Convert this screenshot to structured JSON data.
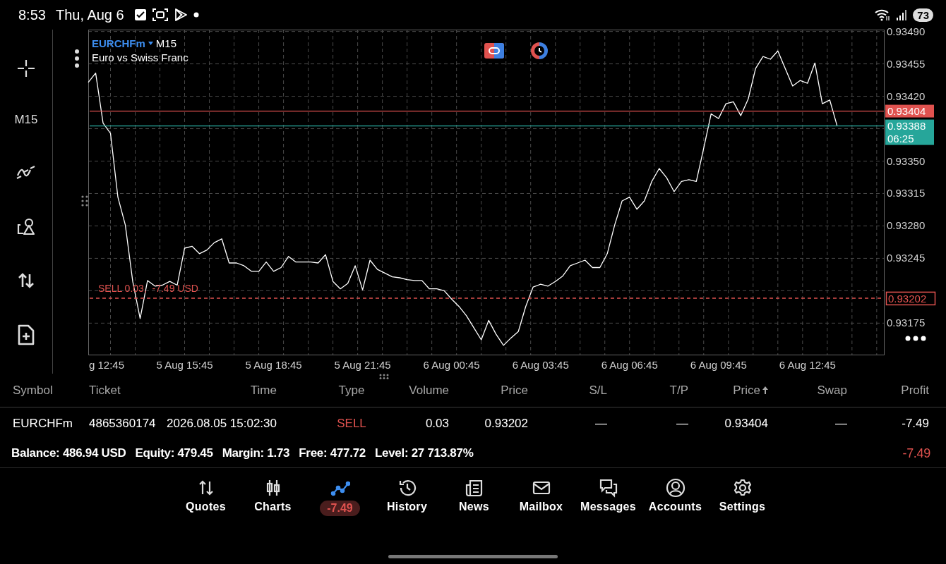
{
  "status_bar": {
    "time": "8:53",
    "date": "Thu, Aug 6",
    "battery": "73"
  },
  "toolbar": {
    "timeframe": "M15"
  },
  "chart": {
    "symbol": "EURCHFm",
    "timeframe": "M15",
    "description": "Euro vs Swiss Franc",
    "chart_data": {
      "type": "line",
      "grid": true,
      "categories": [
        null,
        null,
        null,
        "g 12:45",
        null,
        null,
        null,
        null,
        null,
        null,
        null,
        null,
        null,
        "5 Aug 15:45",
        null,
        null,
        null,
        null,
        null,
        null,
        null,
        null,
        null,
        null,
        null,
        "5 Aug 18:45",
        null,
        null,
        null,
        null,
        null,
        null,
        null,
        null,
        null,
        null,
        null,
        "5 Aug 21:45",
        null,
        null,
        null,
        null,
        null,
        null,
        null,
        null,
        null,
        null,
        null,
        "6 Aug 00:45",
        null,
        null,
        null,
        null,
        null,
        null,
        null,
        null,
        null,
        null,
        null,
        "6 Aug 03:45",
        null,
        null,
        null,
        null,
        null,
        null,
        null,
        null,
        null,
        null,
        null,
        "6 Aug 06:45",
        null,
        null,
        null,
        null,
        null,
        null,
        null,
        null,
        null,
        null,
        null,
        "6 Aug 09:45",
        null,
        null,
        null,
        null,
        null,
        null,
        null,
        null,
        null,
        null,
        null,
        "6 Aug 12:45",
        null,
        null,
        null,
        null,
        null,
        null,
        null,
        null,
        null,
        null
      ],
      "series": [
        {
          "color": "#ffffff",
          "values": [
            0.93435,
            0.93445,
            0.93391,
            0.9338,
            0.93311,
            0.93281,
            0.9322,
            0.9318,
            0.93221,
            0.93215,
            0.93216,
            0.9322,
            0.93216,
            0.93256,
            0.93258,
            0.9325,
            0.93254,
            0.93262,
            0.93266,
            0.9324,
            0.9324,
            0.93237,
            0.93231,
            0.93231,
            0.93241,
            0.93231,
            0.93235,
            0.93247,
            0.93241,
            0.93241,
            0.93241,
            0.9324,
            0.93249,
            0.9322,
            0.93212,
            0.93218,
            0.93237,
            0.93211,
            0.93243,
            0.93233,
            0.93229,
            0.93225,
            0.93224,
            0.93222,
            0.93221,
            0.93221,
            0.93212,
            0.93212,
            0.9321,
            0.93201,
            0.93193,
            0.93183,
            0.9317,
            0.93157,
            0.93178,
            0.93163,
            0.93151,
            0.93159,
            0.93166,
            0.93193,
            0.93214,
            0.93217,
            0.93215,
            0.9322,
            0.93226,
            0.93237,
            0.9324,
            0.93243,
            0.93235,
            0.93235,
            0.9325,
            0.93281,
            0.93307,
            0.93311,
            0.93298,
            0.93307,
            0.93328,
            0.93342,
            0.93332,
            0.93317,
            0.93328,
            0.9333,
            0.93328,
            0.93364,
            0.93401,
            0.93396,
            0.93412,
            0.93414,
            0.93399,
            0.93417,
            0.9345,
            0.93463,
            0.9346,
            0.93469,
            0.9345,
            0.93431,
            0.93437,
            0.93434,
            0.93456,
            0.93412,
            0.93416,
            0.93388,
            null,
            null,
            null,
            null,
            null,
            null
          ]
        }
      ],
      "ylim": [
        0.93141,
        0.93492
      ],
      "yticks": [
        {
          "value": 0.9349,
          "label": "0.93490"
        },
        {
          "value": 0.93455,
          "label": "0.93455"
        },
        {
          "value": 0.9342,
          "label": "0.93420"
        },
        {
          "value": 0.9335,
          "label": "0.93350"
        },
        {
          "value": 0.93315,
          "label": "0.93315"
        },
        {
          "value": 0.9328,
          "label": "0.93280"
        },
        {
          "value": 0.93245,
          "label": "0.93245"
        },
        {
          "value": 0.93175,
          "label": "0.93175"
        }
      ]
    },
    "price_lines": [
      {
        "price": "0.93404",
        "color": "#e0524f",
        "kind": "price"
      },
      {
        "price": "0.93388",
        "color": "#26a69a",
        "kind": "price"
      },
      {
        "price": "0.93202",
        "color": "#e0524f",
        "kind": "order"
      }
    ],
    "countdown": "06:25",
    "order_label": "SELL 0.03,  -7.49 USD"
  },
  "positions": {
    "columns": [
      {
        "label": "Symbol",
        "sorted": false
      },
      {
        "label": "Ticket",
        "sorted": false
      },
      {
        "label": "Time",
        "sorted": false
      },
      {
        "label": "Type",
        "sorted": false
      },
      {
        "label": "Volume",
        "sorted": false
      },
      {
        "label": "Price",
        "sorted": false
      },
      {
        "label": "S/L",
        "sorted": false
      },
      {
        "label": "T/P",
        "sorted": false
      },
      {
        "label": "Price",
        "sorted": true
      },
      {
        "label": "Swap",
        "sorted": false
      },
      {
        "label": "Profit",
        "sorted": false
      }
    ],
    "rows": [
      {
        "cells": [
          "EURCHFm",
          "4865360174",
          "2026.08.05 15:02:30",
          {
            "text": "SELL",
            "color": "#e0524f"
          },
          "0.03",
          "0.93202",
          "—",
          "—",
          "0.93404",
          "—",
          "-7.49"
        ]
      }
    ],
    "summary": [
      {
        "label": "Balance:",
        "value": "486.94 USD"
      },
      {
        "label": "Equity:",
        "value": "479.45"
      },
      {
        "label": "Margin:",
        "value": "1.73"
      },
      {
        "label": "Free:",
        "value": "477.72"
      },
      {
        "label": "Level:",
        "value": "27 713.87%"
      }
    ],
    "total_profit": "-7.49"
  },
  "nav": [
    {
      "kind": "tab",
      "label": "Quotes",
      "selected": false
    },
    {
      "kind": "tab",
      "label": "Charts",
      "selected": false
    },
    {
      "kind": "badge",
      "label": "-7.49",
      "selected": true
    },
    {
      "kind": "tab",
      "label": "History",
      "selected": false
    },
    {
      "kind": "tab",
      "label": "News",
      "selected": false
    },
    {
      "kind": "tab",
      "label": "Mailbox",
      "selected": false
    },
    {
      "kind": "tab",
      "label": "Messages",
      "selected": false
    },
    {
      "kind": "tab",
      "label": "Accounts",
      "selected": false
    },
    {
      "kind": "tab",
      "label": "Settings",
      "selected": false
    }
  ]
}
